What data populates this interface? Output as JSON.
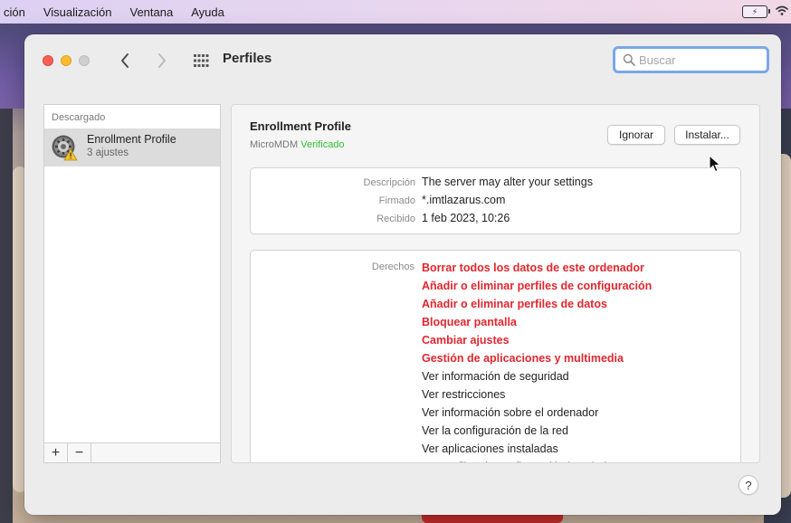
{
  "menubar": {
    "items": [
      "ción",
      "Visualización",
      "Ventana",
      "Ayuda"
    ]
  },
  "window": {
    "title": "Perfiles",
    "search_placeholder": "Buscar"
  },
  "sidebar": {
    "section": "Descargado",
    "items": [
      {
        "name": "Enrollment Profile",
        "subtitle": "3 ajustes"
      }
    ],
    "add_label": "+",
    "remove_label": "−"
  },
  "profile": {
    "name": "Enrollment Profile",
    "organization": "MicroMDM",
    "verified": "Verificado",
    "ignore_label": "Ignorar",
    "install_label": "Instalar...",
    "details": [
      {
        "key": "Descripción",
        "value": "The server may alter your settings"
      },
      {
        "key": "Firmado",
        "value": "*.imtlazarus.com"
      },
      {
        "key": "Recibido",
        "value": "1 feb 2023, 10:26"
      }
    ],
    "rights_label": "Derechos",
    "rights": [
      {
        "text": "Borrar todos los datos de este ordenador",
        "danger": true
      },
      {
        "text": "Añadir o eliminar perfiles de configuración",
        "danger": true
      },
      {
        "text": "Añadir o eliminar perfiles de datos",
        "danger": true
      },
      {
        "text": "Bloquear pantalla",
        "danger": true
      },
      {
        "text": "Cambiar ajustes",
        "danger": true
      },
      {
        "text": "Gestión de aplicaciones y multimedia",
        "danger": true
      },
      {
        "text": "Ver información de seguridad",
        "danger": false
      },
      {
        "text": "Ver restricciones",
        "danger": false
      },
      {
        "text": "Ver información sobre el ordenador",
        "danger": false
      },
      {
        "text": "Ver la configuración de la red",
        "danger": false
      },
      {
        "text": "Ver aplicaciones instaladas",
        "danger": false
      },
      {
        "text": "Ver perfiles de configuración instalados",
        "danger": false
      }
    ]
  },
  "help_label": "?",
  "colors": {
    "danger": "#e0272f",
    "verified": "#2fbf33",
    "focus_ring": "#7aa7e8"
  }
}
